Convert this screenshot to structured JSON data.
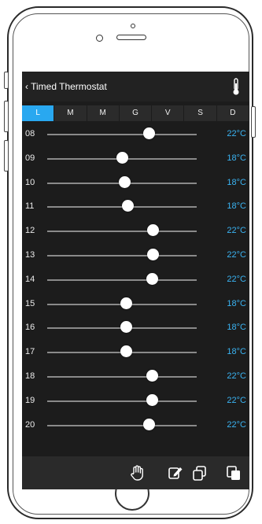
{
  "header": {
    "back_label": "‹ Timed Thermostat",
    "thermometer_icon": "thermometer-icon"
  },
  "days": [
    {
      "label": "L",
      "active": true
    },
    {
      "label": "M",
      "active": false
    },
    {
      "label": "M",
      "active": false
    },
    {
      "label": "G",
      "active": false
    },
    {
      "label": "V",
      "active": false
    },
    {
      "label": "S",
      "active": false
    },
    {
      "label": "D",
      "active": false
    }
  ],
  "rows": [
    {
      "hour": "08",
      "temp": "22°C",
      "level": 0.68
    },
    {
      "hour": "09",
      "temp": "18°C",
      "level": 0.5
    },
    {
      "hour": "10",
      "temp": "18°C",
      "level": 0.52
    },
    {
      "hour": "11",
      "temp": "18°C",
      "level": 0.54
    },
    {
      "hour": "12",
      "temp": "22°C",
      "level": 0.71
    },
    {
      "hour": "13",
      "temp": "22°C",
      "level": 0.71
    },
    {
      "hour": "14",
      "temp": "22°C",
      "level": 0.7
    },
    {
      "hour": "15",
      "temp": "18°C",
      "level": 0.53
    },
    {
      "hour": "16",
      "temp": "18°C",
      "level": 0.53
    },
    {
      "hour": "17",
      "temp": "18°C",
      "level": 0.53
    },
    {
      "hour": "18",
      "temp": "22°C",
      "level": 0.7
    },
    {
      "hour": "19",
      "temp": "22°C",
      "level": 0.7
    },
    {
      "hour": "20",
      "temp": "22°C",
      "level": 0.68
    }
  ],
  "footer": {
    "icons": [
      "hand-icon",
      "edit-icon",
      "copy-icon",
      "paste-icon"
    ]
  },
  "colors": {
    "accent": "#29a8f0",
    "temp_text": "#3ab3f2",
    "screen_bg": "#1c1c1c"
  }
}
